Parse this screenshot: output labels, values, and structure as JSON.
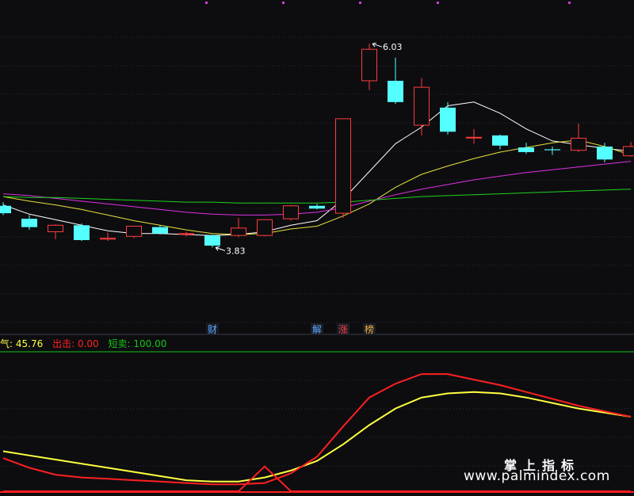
{
  "chart_data": [
    {
      "type": "candlestick",
      "ylim": [
        3.2,
        6.1
      ],
      "candles": [
        {
          "o": 4.28,
          "h": 4.32,
          "l": 4.18,
          "c": 4.2
        },
        {
          "o": 4.14,
          "h": 4.18,
          "l": 4.02,
          "c": 4.05
        },
        {
          "o": 4.0,
          "h": 4.08,
          "l": 3.92,
          "c": 4.07
        },
        {
          "o": 4.07,
          "h": 4.09,
          "l": 3.9,
          "c": 3.91
        },
        {
          "o": 3.92,
          "h": 3.99,
          "l": 3.9,
          "c": 3.93
        },
        {
          "o": 3.95,
          "h": 4.05,
          "l": 3.93,
          "c": 4.06
        },
        {
          "o": 4.05,
          "h": 4.07,
          "l": 3.97,
          "c": 3.98
        },
        {
          "o": 3.98,
          "h": 4.0,
          "l": 3.95,
          "c": 3.98
        },
        {
          "o": 3.96,
          "h": 3.97,
          "l": 3.83,
          "c": 3.85
        },
        {
          "o": 3.96,
          "h": 4.15,
          "l": 3.94,
          "c": 4.04
        },
        {
          "o": 3.96,
          "h": 4.12,
          "l": 3.95,
          "c": 4.13
        },
        {
          "o": 4.14,
          "h": 4.29,
          "l": 4.12,
          "c": 4.28
        },
        {
          "o": 4.28,
          "h": 4.3,
          "l": 4.24,
          "c": 4.25
        },
        {
          "o": 4.2,
          "h": 5.22,
          "l": 4.15,
          "c": 5.22
        },
        {
          "o": 5.63,
          "h": 6.03,
          "l": 5.53,
          "c": 5.97
        },
        {
          "o": 5.63,
          "h": 5.88,
          "l": 5.38,
          "c": 5.4
        },
        {
          "o": 5.15,
          "h": 5.66,
          "l": 5.04,
          "c": 5.56
        },
        {
          "o": 5.34,
          "h": 5.4,
          "l": 5.05,
          "c": 5.08
        },
        {
          "o": 5.02,
          "h": 5.11,
          "l": 4.95,
          "c": 5.02
        },
        {
          "o": 5.04,
          "h": 5.05,
          "l": 4.89,
          "c": 4.93
        },
        {
          "o": 4.91,
          "h": 4.96,
          "l": 4.84,
          "c": 4.86
        },
        {
          "o": 4.89,
          "h": 4.92,
          "l": 4.83,
          "c": 4.88
        },
        {
          "o": 4.88,
          "h": 5.17,
          "l": 4.86,
          "c": 5.01
        },
        {
          "o": 4.92,
          "h": 4.96,
          "l": 4.75,
          "c": 4.78
        },
        {
          "o": 4.82,
          "h": 4.97,
          "l": 4.81,
          "c": 4.92
        }
      ],
      "ma_series": [
        {
          "color": "#ffffff",
          "values": [
            4.29,
            4.19,
            4.13,
            4.07,
            4.01,
            3.98,
            3.98,
            3.97,
            3.96,
            3.97,
            4.0,
            4.07,
            4.12,
            4.35,
            4.65,
            4.95,
            5.13,
            5.36,
            5.4,
            5.28,
            5.11,
            4.98,
            4.94,
            4.9,
            4.87
          ]
        },
        {
          "color": "#e8e43a",
          "values": [
            4.38,
            4.33,
            4.29,
            4.24,
            4.18,
            4.12,
            4.07,
            4.02,
            3.98,
            3.97,
            3.98,
            4.03,
            4.06,
            4.17,
            4.3,
            4.48,
            4.62,
            4.71,
            4.79,
            4.86,
            4.91,
            4.96,
            4.99,
            4.92,
            4.83
          ]
        },
        {
          "color": "#e030e0",
          "values": [
            4.41,
            4.39,
            4.36,
            4.33,
            4.3,
            4.27,
            4.24,
            4.21,
            4.19,
            4.18,
            4.18,
            4.19,
            4.21,
            4.26,
            4.33,
            4.4,
            4.46,
            4.51,
            4.56,
            4.6,
            4.64,
            4.67,
            4.7,
            4.73,
            4.76
          ]
        },
        {
          "color": "#1ed21e",
          "values": [
            4.38,
            4.37,
            4.37,
            4.36,
            4.35,
            4.34,
            4.33,
            4.32,
            4.32,
            4.31,
            4.31,
            4.31,
            4.31,
            4.32,
            4.34,
            4.36,
            4.38,
            4.39,
            4.4,
            4.41,
            4.42,
            4.43,
            4.44,
            4.45,
            4.46
          ]
        }
      ],
      "annotations": [
        {
          "text": "6.03",
          "candle": 14,
          "price": 6.03,
          "color": "#ffffff"
        },
        {
          "text": "3.83",
          "candle": 8,
          "price": 3.83,
          "color": "#ffffff"
        }
      ],
      "event_tags": [
        {
          "text": "财",
          "candle": 8,
          "color": "#5aa8ff"
        },
        {
          "text": "解",
          "candle": 12,
          "color": "#5aa8ff"
        },
        {
          "text": "涨",
          "candle": 13,
          "color": "#ff3c3c"
        },
        {
          "text": "榜",
          "candle": 14,
          "color": "#f0b040"
        }
      ]
    },
    {
      "type": "line",
      "ylim": [
        0,
        100
      ],
      "legend": [
        {
          "label": "气:",
          "value": "45.76",
          "color": "#ffff40"
        },
        {
          "label": "出击:",
          "value": "0.00",
          "color": "#ff2020"
        },
        {
          "label": "短卖:",
          "value": "100.00",
          "color": "#18c418"
        }
      ],
      "series": [
        {
          "color": "#ffff40",
          "values": [
            29,
            26,
            23,
            20,
            17,
            14,
            11,
            8,
            7,
            7,
            10,
            15,
            22,
            34,
            48,
            60,
            68,
            71,
            72,
            71,
            68,
            64,
            60,
            57,
            54
          ]
        },
        {
          "color": "#ff2020",
          "values": [
            24,
            17,
            12,
            10,
            9,
            8,
            7,
            6,
            5,
            5,
            6,
            13,
            25,
            47,
            68,
            78,
            85,
            85,
            81,
            77,
            72,
            67,
            62,
            58,
            54
          ]
        },
        {
          "color": "#ff2020",
          "values": [
            0,
            0,
            0,
            0,
            0,
            0,
            0,
            0,
            0,
            0,
            18,
            0,
            0,
            0,
            0,
            0,
            0,
            0,
            0,
            0,
            0,
            0,
            0,
            0,
            0
          ]
        }
      ]
    }
  ],
  "watermark": {
    "cn": "掌上指标",
    "url": "www.palmindex.com"
  }
}
